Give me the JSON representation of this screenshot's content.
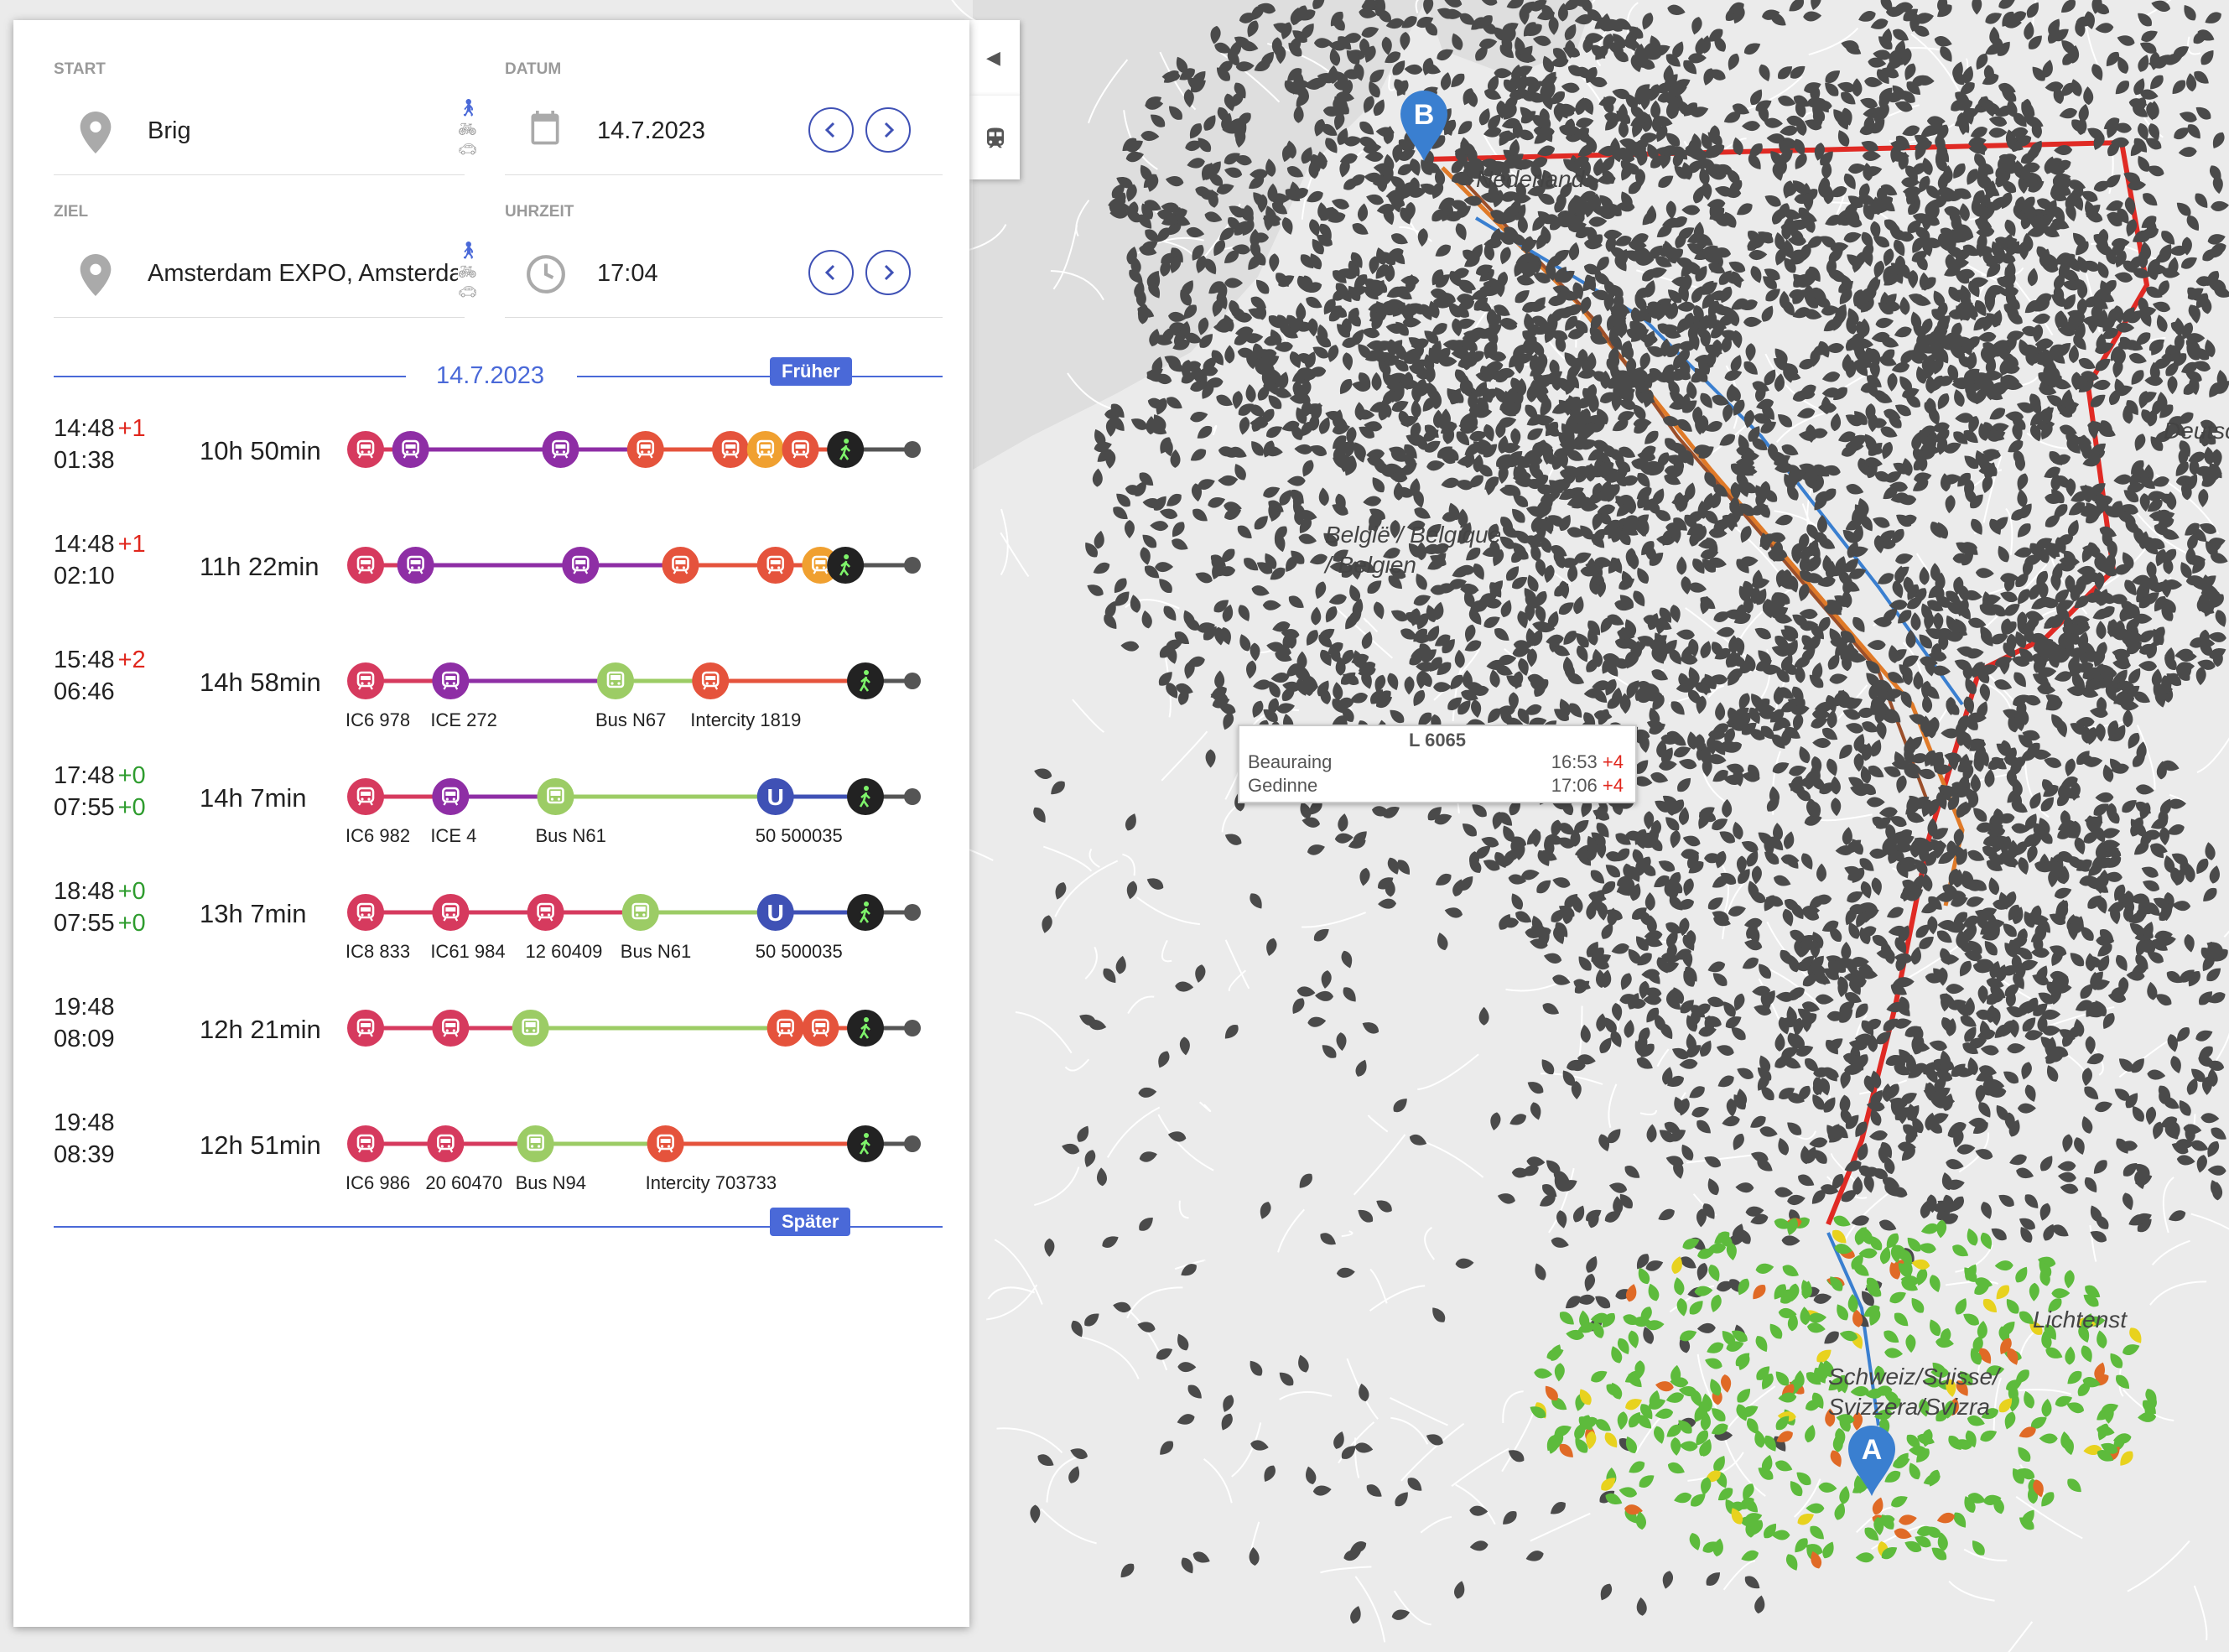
{
  "form": {
    "start": {
      "label": "START",
      "value": "Brig"
    },
    "ziel": {
      "label": "ZIEL",
      "value": "Amsterdam EXPO, Amsterdam"
    },
    "datum": {
      "label": "DATUM",
      "value": "14.7.2023"
    },
    "uhrzeit": {
      "label": "UHRZEIT",
      "value": "17:04"
    }
  },
  "list": {
    "date_header": "14.7.2023",
    "earlier_label": "Früher",
    "later_label": "Später"
  },
  "colors": {
    "ic_red": "#d63a5e",
    "ice_purple": "#8e2ea5",
    "rail_red": "#e5533c",
    "orange": "#f0a030",
    "bus_green": "#9ccc65",
    "ubahn_blue": "#3f51b5",
    "walk_black": "#222222",
    "accent_blue": "#4a69d8"
  },
  "connections": [
    {
      "dep": "14:48",
      "dep_delay": "+1",
      "arr": "01:38",
      "arr_delay": "",
      "duration": "10h 50min",
      "legs": [
        {
          "color": "#d63a5e",
          "icon": "train-icon",
          "start": 0.0,
          "label": ""
        },
        {
          "color": "#8e2ea5",
          "icon": "train-icon",
          "start": 0.09,
          "label": ""
        },
        {
          "color": "#8e2ea5",
          "icon": "train-icon",
          "start": 0.39,
          "label": ""
        },
        {
          "color": "#e5533c",
          "icon": "train-icon",
          "start": 0.56,
          "label": ""
        },
        {
          "color": "#e5533c",
          "icon": "train-icon",
          "start": 0.73,
          "label": ""
        },
        {
          "color": "#f0a030",
          "icon": "train-icon",
          "start": 0.8,
          "label": ""
        },
        {
          "color": "#e5533c",
          "icon": "train-icon",
          "start": 0.87,
          "label": ""
        },
        {
          "color": "#222222",
          "icon": "walk-icon",
          "start": 0.96,
          "label": ""
        }
      ]
    },
    {
      "dep": "14:48",
      "dep_delay": "+1",
      "arr": "02:10",
      "arr_delay": "",
      "duration": "11h 22min",
      "legs": [
        {
          "color": "#d63a5e",
          "icon": "train-icon",
          "start": 0.0,
          "label": ""
        },
        {
          "color": "#8e2ea5",
          "icon": "train-icon",
          "start": 0.1,
          "label": ""
        },
        {
          "color": "#8e2ea5",
          "icon": "train-icon",
          "start": 0.43,
          "label": ""
        },
        {
          "color": "#e5533c",
          "icon": "train-icon",
          "start": 0.63,
          "label": ""
        },
        {
          "color": "#e5533c",
          "icon": "train-icon",
          "start": 0.82,
          "label": ""
        },
        {
          "color": "#f0a030",
          "icon": "train-icon",
          "start": 0.91,
          "label": ""
        },
        {
          "color": "#222222",
          "icon": "walk-icon",
          "start": 0.96,
          "label": ""
        }
      ]
    },
    {
      "dep": "15:48",
      "dep_delay": "+2",
      "arr": "06:46",
      "arr_delay": "",
      "duration": "14h 58min",
      "legs": [
        {
          "color": "#d63a5e",
          "icon": "train-icon",
          "start": 0.0,
          "label": "IC6 978"
        },
        {
          "color": "#8e2ea5",
          "icon": "train-icon",
          "start": 0.17,
          "label": "ICE 272"
        },
        {
          "color": "#9ccc65",
          "icon": "bus-icon",
          "start": 0.5,
          "label": "Bus N67"
        },
        {
          "color": "#e5533c",
          "icon": "train-icon",
          "start": 0.69,
          "label": "Intercity 1819"
        },
        {
          "color": "#222222",
          "icon": "walk-icon",
          "start": 1.0,
          "label": ""
        }
      ]
    },
    {
      "dep": "17:48",
      "dep_delay": "+0",
      "arr": "07:55",
      "arr_delay": "+0",
      "duration": "14h 7min",
      "legs": [
        {
          "color": "#d63a5e",
          "icon": "train-icon",
          "start": 0.0,
          "label": "IC6 982"
        },
        {
          "color": "#8e2ea5",
          "icon": "train-icon",
          "start": 0.17,
          "label": "ICE 4"
        },
        {
          "color": "#9ccc65",
          "icon": "bus-icon",
          "start": 0.38,
          "label": "Bus N61"
        },
        {
          "color": "#3f51b5",
          "icon": "ubahn-icon",
          "start": 0.82,
          "label": "50 500035"
        },
        {
          "color": "#222222",
          "icon": "walk-icon",
          "start": 1.0,
          "label": ""
        }
      ]
    },
    {
      "dep": "18:48",
      "dep_delay": "+0",
      "arr": "07:55",
      "arr_delay": "+0",
      "duration": "13h 7min",
      "legs": [
        {
          "color": "#d63a5e",
          "icon": "train-icon",
          "start": 0.0,
          "label": "IC8 833"
        },
        {
          "color": "#d63a5e",
          "icon": "train-icon",
          "start": 0.17,
          "label": "IC61 984"
        },
        {
          "color": "#d63a5e",
          "icon": "train-icon",
          "start": 0.36,
          "label": "12 60409"
        },
        {
          "color": "#9ccc65",
          "icon": "bus-icon",
          "start": 0.55,
          "label": "Bus N61"
        },
        {
          "color": "#3f51b5",
          "icon": "ubahn-icon",
          "start": 0.82,
          "label": "50 500035"
        },
        {
          "color": "#222222",
          "icon": "walk-icon",
          "start": 1.0,
          "label": ""
        }
      ]
    },
    {
      "dep": "19:48",
      "dep_delay": "",
      "arr": "08:09",
      "arr_delay": "",
      "duration": "12h 21min",
      "legs": [
        {
          "color": "#d63a5e",
          "icon": "train-icon",
          "start": 0.0,
          "label": ""
        },
        {
          "color": "#d63a5e",
          "icon": "train-icon",
          "start": 0.17,
          "label": ""
        },
        {
          "color": "#9ccc65",
          "icon": "bus-icon",
          "start": 0.33,
          "label": ""
        },
        {
          "color": "#e5533c",
          "icon": "train-icon",
          "start": 0.84,
          "label": ""
        },
        {
          "color": "#e5533c",
          "icon": "train-icon",
          "start": 0.91,
          "label": ""
        },
        {
          "color": "#222222",
          "icon": "walk-icon",
          "start": 1.0,
          "label": ""
        }
      ]
    },
    {
      "dep": "19:48",
      "dep_delay": "",
      "arr": "08:39",
      "arr_delay": "",
      "duration": "12h 51min",
      "legs": [
        {
          "color": "#d63a5e",
          "icon": "train-icon",
          "start": 0.0,
          "label": "IC6 986"
        },
        {
          "color": "#d63a5e",
          "icon": "train-icon",
          "start": 0.16,
          "label": "20 60470"
        },
        {
          "color": "#9ccc65",
          "icon": "bus-icon",
          "start": 0.34,
          "label": "Bus N94"
        },
        {
          "color": "#e5533c",
          "icon": "train-icon",
          "start": 0.6,
          "label": "Intercity 703733"
        },
        {
          "color": "#222222",
          "icon": "walk-icon",
          "start": 1.0,
          "label": ""
        }
      ]
    }
  ],
  "map": {
    "labels": {
      "nederland": "Nederland",
      "belgique": "België / Belgique / Belgien",
      "deutschland": "Deutsc",
      "schweiz": "Schweiz/Suisse/ Svizzera/Svizra",
      "liechtenstein": "Lichtenst"
    },
    "marker_a": "A",
    "marker_b": "B",
    "popup": {
      "train": "L 6065",
      "stops": [
        {
          "name": "Beauraing",
          "time": "16:53",
          "delay": "+4"
        },
        {
          "name": "Gedinne",
          "time": "17:06",
          "delay": "+4"
        }
      ]
    }
  }
}
